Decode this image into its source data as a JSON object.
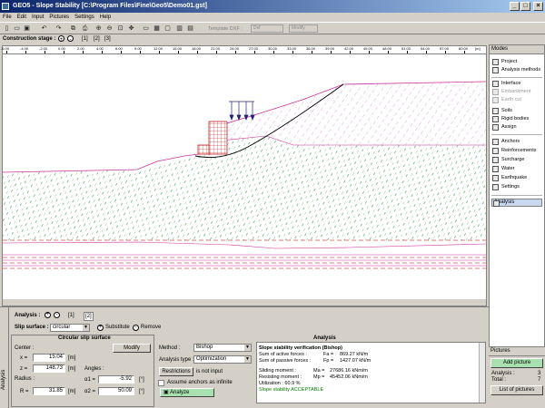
{
  "window": {
    "title": "GEO5 - Slope Stability [C:\\Program Files\\Fine\\Geo5\\Demo01.gst]"
  },
  "menu": [
    "File",
    "Edit",
    "Input",
    "Pictures",
    "Settings",
    "Help"
  ],
  "toolbar": {
    "template_label": "Template DXF :",
    "dxf_value": "Dxf",
    "modify_label": "Modify"
  },
  "stage": {
    "label": "Construction stage :",
    "stages": [
      "[1]",
      "[2]",
      "[3]"
    ]
  },
  "ruler": {
    "unit": "[m]",
    "ticks": [
      "-6.00",
      "-4.00",
      "-2.00",
      "0.00",
      "2.00",
      "4.00",
      "6.00",
      "9.00",
      "12.00",
      "15.00",
      "18.00",
      "21.00",
      "24.00",
      "27.00",
      "30.00",
      "33.00",
      "36.00",
      "39.00",
      "42.00",
      "45.00",
      "48.00",
      "51.00",
      "54.00",
      "57.00",
      "60.00"
    ]
  },
  "modes": {
    "header": "Modes",
    "items": [
      {
        "label": "Project",
        "enabled": true
      },
      {
        "label": "Analysis methods",
        "enabled": true
      },
      {
        "label": "Interface",
        "enabled": true
      },
      {
        "label": "Embankment",
        "enabled": false
      },
      {
        "label": "Earth cut",
        "enabled": false
      },
      {
        "label": "Soils",
        "enabled": true
      },
      {
        "label": "Rigid bodies",
        "enabled": true
      },
      {
        "label": "Assign",
        "enabled": true
      },
      {
        "label": "Anchors",
        "enabled": true
      },
      {
        "label": "Reinforcements",
        "enabled": true
      },
      {
        "label": "Surcharge",
        "enabled": true
      },
      {
        "label": "Water",
        "enabled": true
      },
      {
        "label": "Earthquake",
        "enabled": true
      },
      {
        "label": "Settings",
        "enabled": true
      },
      {
        "label": "Analysis",
        "enabled": true
      }
    ]
  },
  "pictures": {
    "header": "Pictures",
    "add_label": "Add picture",
    "analysis_label": "Analysis :",
    "analysis_count": "3",
    "total_label": "Total :",
    "total_count": "7",
    "list_label": "List of pictures"
  },
  "analysis": {
    "side_tab": "Analysis",
    "bar_label": "Analysis :",
    "tabs": [
      "[1]",
      "[2]"
    ],
    "slip_label": "Slip surface :",
    "slip_value": "circular",
    "substitute_label": "Substitute",
    "remove_label": "Remove",
    "circ_title": "Circular slip surface",
    "center_label": "Center :",
    "modify_label": "Modify",
    "x_label": "x =",
    "x_value": "15.04",
    "x_unit": "[m]",
    "z_label": "z =",
    "z_value": "148.73",
    "z_unit": "[m]",
    "radius_label": "Radius :",
    "r_label": "R =",
    "r_value": "31.85",
    "r_unit": "[m]",
    "angles_label": "Angles :",
    "a1_label": "α1 =",
    "a1_value": "-5.92",
    "a1_unit": "[°]",
    "a2_label": "α2 =",
    "a2_value": "50.09",
    "a2_unit": "[°]",
    "assume_label": "Assume anchors as infinite",
    "method_label": "Method :",
    "method_value": "Bishop",
    "atype_label": "Analysis type :",
    "atype_value": "Optimization",
    "restrictions_label": "Restrictions",
    "not_input": "is not input",
    "analyze_label": "Analyze",
    "panel_title": "Analysis",
    "result_title": "Slope stability verification (Bishop)",
    "results": [
      {
        "label": "Sum of active forces :",
        "sym": "Fa =",
        "value": "869.27 kN/m"
      },
      {
        "label": "Sum of passive forces :",
        "sym": "Fp =",
        "value": "1427.07 kN/m"
      },
      {
        "label": "Sliding moment :",
        "sym": "Ma =",
        "value": "27686.16 kNm/m"
      },
      {
        "label": "Resisting moment :",
        "sym": "Mp =",
        "value": "45452.06 kNm/m"
      }
    ],
    "utilization": "Utilization : 60.9 %",
    "verdict": "Slope stability ACCEPTABLE"
  }
}
